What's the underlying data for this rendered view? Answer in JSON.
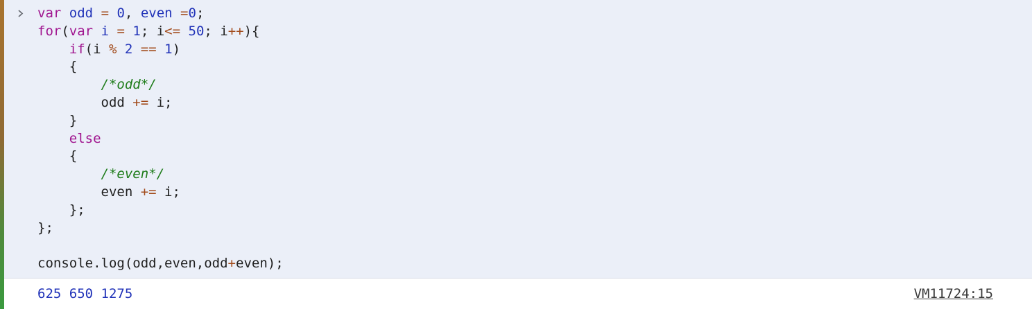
{
  "console": {
    "prompt_icon": "chevron-right-icon",
    "input_lines": [
      {
        "parts": [
          {
            "t": "var",
            "c": "kw"
          },
          {
            "t": " ",
            "c": "punc"
          },
          {
            "t": "odd",
            "c": "var"
          },
          {
            "t": " ",
            "c": "punc"
          },
          {
            "t": "=",
            "c": "op"
          },
          {
            "t": " ",
            "c": "punc"
          },
          {
            "t": "0",
            "c": "num"
          },
          {
            "t": ", ",
            "c": "punc"
          },
          {
            "t": "even",
            "c": "var"
          },
          {
            "t": " ",
            "c": "punc"
          },
          {
            "t": "=",
            "c": "op"
          },
          {
            "t": "0",
            "c": "num"
          },
          {
            "t": ";",
            "c": "punc"
          }
        ]
      },
      {
        "parts": [
          {
            "t": "for",
            "c": "kw"
          },
          {
            "t": "(",
            "c": "punc"
          },
          {
            "t": "var",
            "c": "kw"
          },
          {
            "t": " ",
            "c": "punc"
          },
          {
            "t": "i",
            "c": "var"
          },
          {
            "t": " ",
            "c": "punc"
          },
          {
            "t": "=",
            "c": "op"
          },
          {
            "t": " ",
            "c": "punc"
          },
          {
            "t": "1",
            "c": "num"
          },
          {
            "t": "; i",
            "c": "punc"
          },
          {
            "t": "<=",
            "c": "op"
          },
          {
            "t": " ",
            "c": "punc"
          },
          {
            "t": "50",
            "c": "num"
          },
          {
            "t": "; i",
            "c": "punc"
          },
          {
            "t": "++",
            "c": "op"
          },
          {
            "t": "){",
            "c": "punc"
          }
        ]
      },
      {
        "parts": [
          {
            "t": "    ",
            "c": "punc"
          },
          {
            "t": "if",
            "c": "kw"
          },
          {
            "t": "(i ",
            "c": "punc"
          },
          {
            "t": "%",
            "c": "op"
          },
          {
            "t": " ",
            "c": "punc"
          },
          {
            "t": "2",
            "c": "num"
          },
          {
            "t": " ",
            "c": "punc"
          },
          {
            "t": "==",
            "c": "op"
          },
          {
            "t": " ",
            "c": "punc"
          },
          {
            "t": "1",
            "c": "num"
          },
          {
            "t": ")",
            "c": "punc"
          }
        ]
      },
      {
        "parts": [
          {
            "t": "    {",
            "c": "punc"
          }
        ]
      },
      {
        "parts": [
          {
            "t": "        ",
            "c": "punc"
          },
          {
            "t": "/*odd*/",
            "c": "cm"
          }
        ]
      },
      {
        "parts": [
          {
            "t": "        odd ",
            "c": "punc"
          },
          {
            "t": "+=",
            "c": "op"
          },
          {
            "t": " i;",
            "c": "punc"
          }
        ]
      },
      {
        "parts": [
          {
            "t": "    }",
            "c": "punc"
          }
        ]
      },
      {
        "parts": [
          {
            "t": "    ",
            "c": "punc"
          },
          {
            "t": "else",
            "c": "kw"
          }
        ]
      },
      {
        "parts": [
          {
            "t": "    {",
            "c": "punc"
          }
        ]
      },
      {
        "parts": [
          {
            "t": "        ",
            "c": "punc"
          },
          {
            "t": "/*even*/",
            "c": "cm"
          }
        ]
      },
      {
        "parts": [
          {
            "t": "        even ",
            "c": "punc"
          },
          {
            "t": "+=",
            "c": "op"
          },
          {
            "t": " i;",
            "c": "punc"
          }
        ]
      },
      {
        "parts": [
          {
            "t": "    };",
            "c": "punc"
          }
        ]
      },
      {
        "parts": [
          {
            "t": "};",
            "c": "punc"
          }
        ]
      },
      {
        "parts": [
          {
            "t": "",
            "c": "punc"
          }
        ]
      },
      {
        "parts": [
          {
            "t": "console.log(odd,even,odd",
            "c": "punc"
          },
          {
            "t": "+",
            "c": "op"
          },
          {
            "t": "even);",
            "c": "punc"
          }
        ]
      }
    ],
    "output": {
      "values": "625 650 1275",
      "source_link": "VM11724:15"
    }
  }
}
